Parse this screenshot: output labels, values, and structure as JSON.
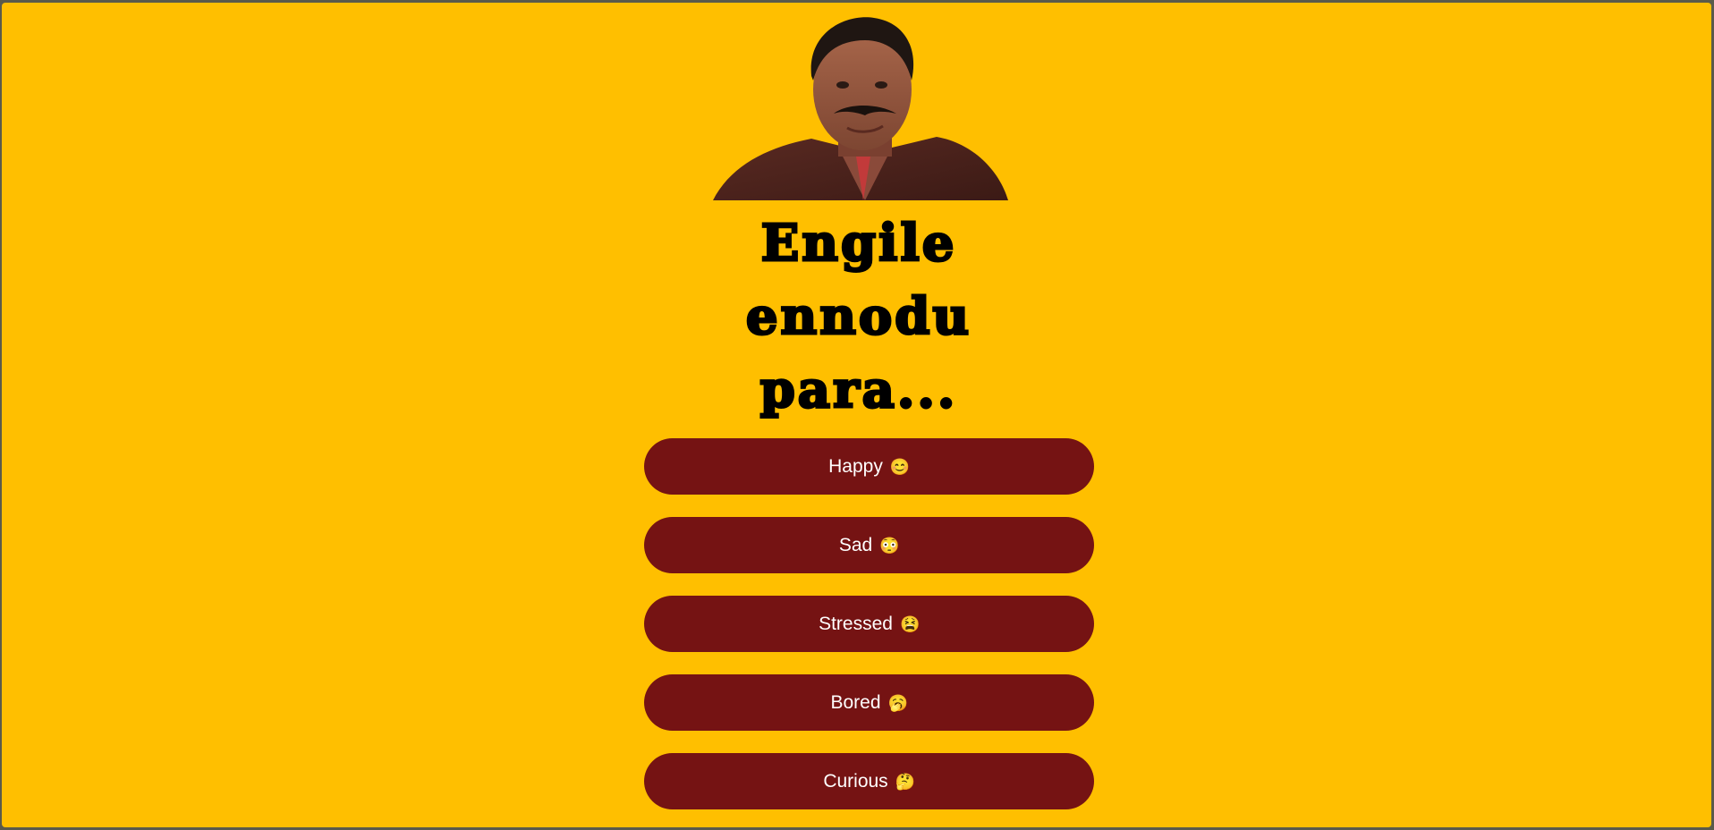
{
  "page": {
    "background_color": "#ffbf00",
    "accent_color": "#751313"
  },
  "header": {
    "image_icon": "man-with-mustache-photo",
    "title_lines": [
      "Engile",
      "ennodu",
      "para..."
    ]
  },
  "moods": [
    {
      "label": "Happy",
      "emoji": "😊",
      "icon": "smiling-face-icon"
    },
    {
      "label": "Sad",
      "emoji": "😳",
      "icon": "flushed-face-icon"
    },
    {
      "label": "Stressed",
      "emoji": "😫",
      "icon": "tired-face-icon"
    },
    {
      "label": "Bored",
      "emoji": "🥱",
      "icon": "yawning-face-icon"
    },
    {
      "label": "Curious",
      "emoji": "🤔",
      "icon": "thinking-face-icon"
    }
  ]
}
